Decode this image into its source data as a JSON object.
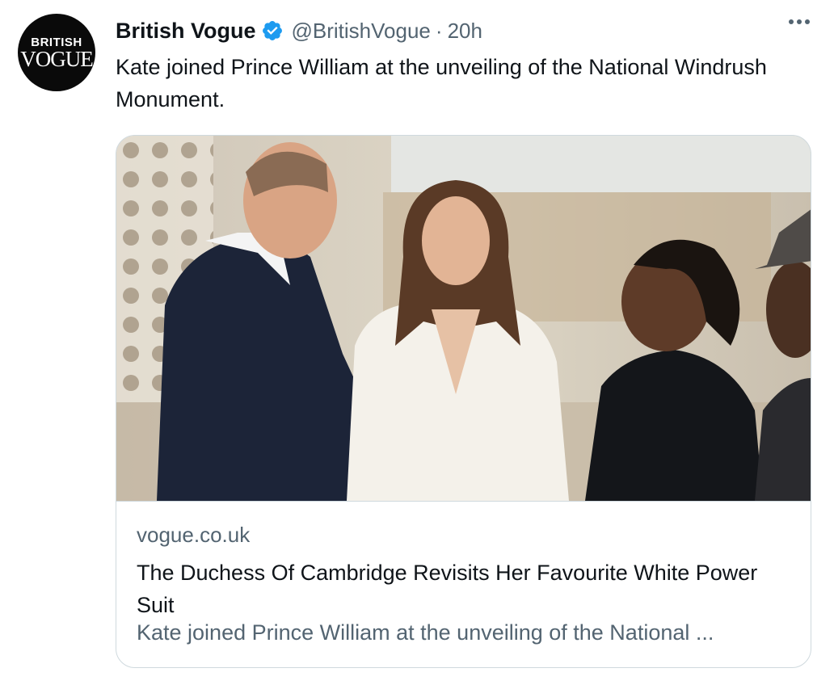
{
  "account": {
    "avatar_line1": "BRITISH",
    "avatar_line2": "VOGUE",
    "name": "British Vogue",
    "handle": "@BritishVogue",
    "separator": "·",
    "time": "20h",
    "verified_color": "#1d9bf0"
  },
  "tweet": {
    "text": "Kate joined Prince William at the unveiling of the National Windrush Monument."
  },
  "link_card": {
    "domain": "vogue.co.uk",
    "title": "The Duchess Of Cambridge Revisits Her Favourite White Power Suit",
    "description": "Kate joined Prince William at the unveiling of the National ..."
  },
  "icons": {
    "verified": "verified-badge-icon",
    "more": "more-options-icon"
  },
  "colors": {
    "text": "#0f1419",
    "secondary": "#536471",
    "border": "#cfd9de"
  }
}
